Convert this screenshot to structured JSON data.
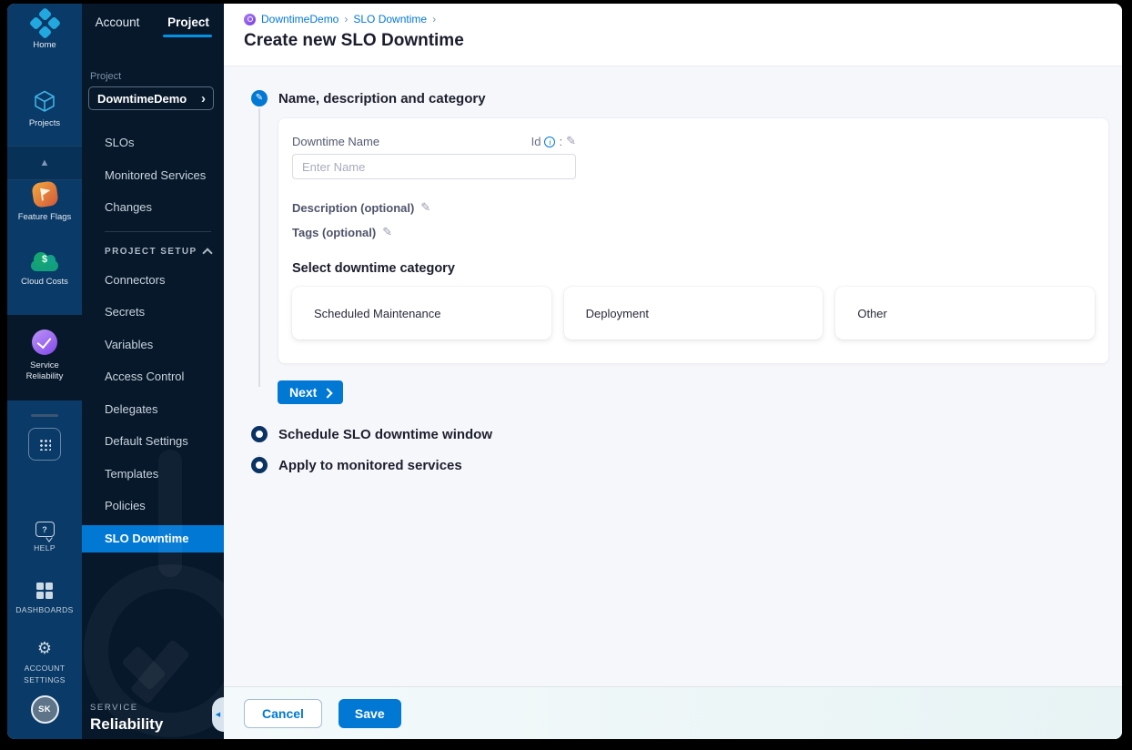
{
  "colors": {
    "accent": "#0278d5",
    "tab_underline": "#0092e4",
    "rail_blue": "#0a3a67",
    "navy_dark": "#07182b",
    "step_ring": "#0a3364",
    "purple": "#8347ea",
    "orange": "#e8833c",
    "teal": "#12a07c",
    "content_bg": "#f6f7fa"
  },
  "glyphs": {
    "pencil": "✎",
    "triangle_up": "▲",
    "gear": "⚙",
    "chevron": "›",
    "collapse": "◀",
    "info": "i",
    "dollar": "$",
    "question": "?",
    "colon": ":",
    "separator": "›"
  },
  "rail": {
    "items": [
      {
        "label": "Home"
      },
      {
        "label": "Projects"
      },
      {
        "label": "Feature Flags"
      },
      {
        "label": "Cloud Costs"
      },
      {
        "label": "Service Reliability"
      }
    ],
    "help": "HELP",
    "dashboards": "DASHBOARDS",
    "account_settings": "ACCOUNT SETTINGS",
    "avatar": "SK"
  },
  "sidebar": {
    "tabs": {
      "account": "Account",
      "project": "Project"
    },
    "project_section": {
      "label": "Project",
      "value": "DowntimeDemo"
    },
    "nav": [
      "SLOs",
      "Monitored Services",
      "Changes"
    ],
    "setup": {
      "header": "PROJECT SETUP",
      "items": [
        "Connectors",
        "Secrets",
        "Variables",
        "Access Control",
        "Delegates",
        "Default Settings",
        "Templates",
        "Policies",
        "SLO Downtime"
      ]
    },
    "module": {
      "kicker": "SERVICE",
      "name": "Reliability"
    }
  },
  "header": {
    "breadcrumb": {
      "project": "DowntimeDemo",
      "section": "SLO Downtime"
    },
    "title": "Create new SLO Downtime"
  },
  "wizard": {
    "step1": {
      "title": "Name, description and category",
      "name_label": "Downtime Name",
      "id_label": "Id",
      "name_placeholder": "Enter Name",
      "description_label": "Description (optional)",
      "tags_label": "Tags (optional)",
      "category_label": "Select downtime category",
      "categories": [
        "Scheduled Maintenance",
        "Deployment",
        "Other"
      ],
      "next": "Next"
    },
    "step2": {
      "title": "Schedule SLO downtime window"
    },
    "step3": {
      "title": "Apply to monitored services"
    }
  },
  "footer": {
    "cancel": "Cancel",
    "save": "Save"
  }
}
